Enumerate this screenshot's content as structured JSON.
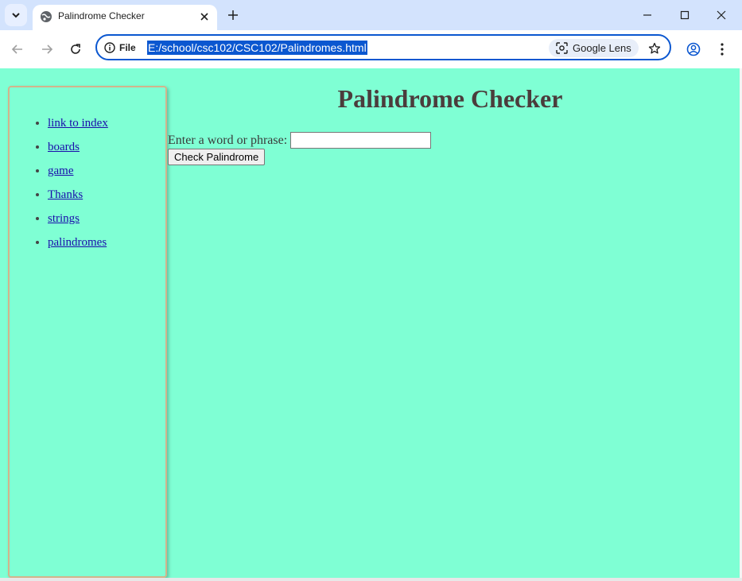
{
  "browser": {
    "tab": {
      "title": "Palindrome Checker"
    },
    "omnibox": {
      "site_info_label": "File",
      "url": "E:/school/csc102/CSC102/Palindromes.html",
      "lens_label": "Google Lens"
    }
  },
  "page": {
    "sidebar": {
      "links": [
        {
          "label": "link to index"
        },
        {
          "label": "boards"
        },
        {
          "label": "game"
        },
        {
          "label": "Thanks"
        },
        {
          "label": "strings"
        },
        {
          "label": "palindromes"
        }
      ]
    },
    "heading": "Palindrome Checker",
    "form": {
      "prompt": "Enter a word or phrase:",
      "input_value": "",
      "button_label": "Check Palindrome"
    }
  },
  "colors": {
    "page_background": "#7fffd4",
    "sidebar_border": "#d2b48c",
    "heading": "#4b3c3c",
    "tab_strip": "#d3e3fd",
    "accent": "#0b57d0"
  }
}
